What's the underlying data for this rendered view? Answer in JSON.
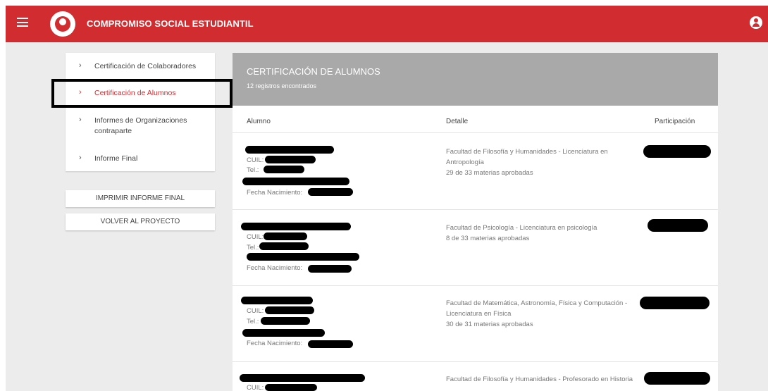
{
  "header": {
    "title": "COMPROMISO SOCIAL ESTUDIANTIL"
  },
  "sidebar": {
    "items": [
      {
        "label": "Certificación de Colaboradores"
      },
      {
        "label": "Certificación de Alumnos"
      },
      {
        "label": "Informes de Organizaciones contraparte"
      },
      {
        "label": "Informe Final"
      }
    ],
    "chevron": "›"
  },
  "buttons": {
    "print": "IMPRIMIR INFORME FINAL",
    "back": "VOLVER AL PROYECTO"
  },
  "panel": {
    "title": "CERTIFICACIÓN DE ALUMNOS",
    "subtitle": "12 registros encontrados",
    "columns": [
      "Alumno",
      "Detalle",
      "Participación"
    ]
  },
  "field_labels": {
    "cuil": "CUIL:",
    "tel": "Tel.:",
    "fecha": "Fecha Nacimiento:"
  },
  "rows": [
    {
      "detail": "Facultad de Filosofía y Humanidades - Licenciatura en Antropología",
      "materias": "29 de 33 materias aprobadas"
    },
    {
      "detail": "Facultad de Psicología - Licenciatura en psicología",
      "materias": "8 de 33 materias aprobadas"
    },
    {
      "detail": "Facultad de Matemática, Astronomía, Física y Computación - Licenciatura en Física",
      "materias": "30 de 31 materias aprobadas"
    },
    {
      "detail": "Facultad de Filosofía y Humanidades - Profesorado en Historia",
      "materias": ""
    }
  ],
  "colors": {
    "brand": "#d12c30",
    "panel_header": "#a9a9a9",
    "redaction": "#000000"
  },
  "icons": [
    "menu-icon",
    "logo-icon",
    "user-account-icon",
    "chevron-right-icon"
  ]
}
